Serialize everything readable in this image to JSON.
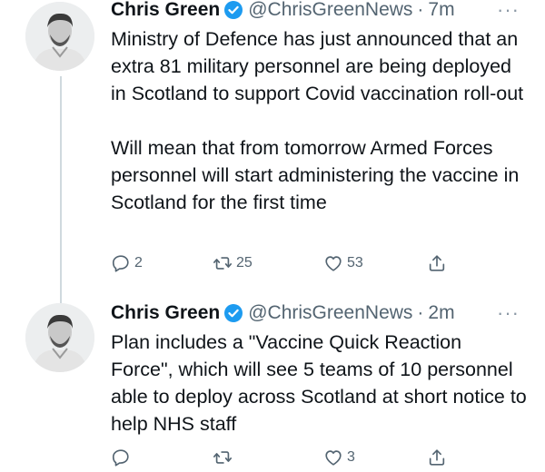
{
  "thread": {
    "tweets": [
      {
        "author_name": "Chris Green",
        "handle": "@ChrisGreenNews",
        "separator": "·",
        "time": "7m",
        "more": "···",
        "text": "Ministry of Defence has just announced that an extra 81 military personnel are being deployed in Scotland to support Covid vaccination roll-out\n\nWill mean that from tomorrow Armed Forces personnel will start administering the vaccine in Scotland for the first time",
        "reply_count": "2",
        "retweet_count": "25",
        "like_count": "53",
        "share_count": ""
      },
      {
        "author_name": "Chris Green",
        "handle": "@ChrisGreenNews",
        "separator": "·",
        "time": "2m",
        "more": "···",
        "text": "Plan includes a \"Vaccine Quick Reaction Force\", which will see 5 teams of 10 personnel able to deploy across Scotland at short notice to help NHS staff",
        "reply_count": "",
        "retweet_count": "",
        "like_count": "3",
        "share_count": ""
      }
    ]
  },
  "colors": {
    "verified": "#1d9bf0",
    "secondary_text": "#536471",
    "primary_text": "#0f1419",
    "thread_line": "#cfd9de"
  },
  "icons": {
    "verified": "verified-badge-icon",
    "reply": "reply-icon",
    "retweet": "retweet-icon",
    "like": "heart-icon",
    "share": "share-icon",
    "more": "more-icon"
  }
}
